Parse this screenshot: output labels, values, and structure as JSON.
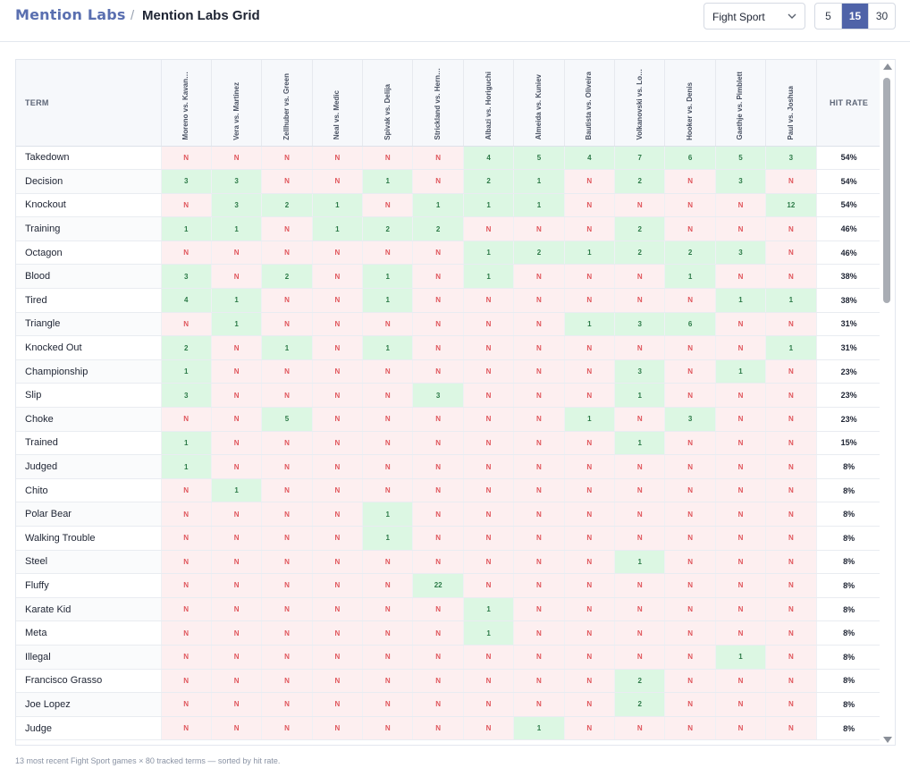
{
  "header": {
    "brand": "Mention Labs",
    "separator": "/",
    "title": "Mention Labs Grid",
    "sport_select": {
      "value": "Fight Sport",
      "icon": "chevron-down-icon"
    },
    "counts": [
      {
        "label": "5",
        "active": false
      },
      {
        "label": "15",
        "active": true
      },
      {
        "label": "30",
        "active": false
      }
    ]
  },
  "grid": {
    "term_header": "TERM",
    "rate_header": "HIT RATE",
    "games": [
      "Moreno vs. Kavan…",
      "Vera vs. Martinez",
      "Zellhuber vs. Green",
      "Neal vs. Medic",
      "Spivak vs. Delija",
      "Strickland vs. Hern…",
      "Albazi vs. Horiguchi",
      "Almeida vs. Kuniev",
      "Bautista vs. Oliveira",
      "Volkanovski vs. Lo…",
      "Hooker vs. Denis",
      "Gaethje vs. Pimblett",
      "Paul vs. Joshua"
    ],
    "rows": [
      {
        "term": "Takedown",
        "cells": [
          "N",
          "N",
          "N",
          "N",
          "N",
          "N",
          "4",
          "5",
          "4",
          "7",
          "6",
          "5",
          "3"
        ],
        "rate": "54%"
      },
      {
        "term": "Decision",
        "cells": [
          "3",
          "3",
          "N",
          "N",
          "1",
          "N",
          "2",
          "1",
          "N",
          "2",
          "N",
          "3",
          "N"
        ],
        "rate": "54%"
      },
      {
        "term": "Knockout",
        "cells": [
          "N",
          "3",
          "2",
          "1",
          "N",
          "1",
          "1",
          "1",
          "N",
          "N",
          "N",
          "N",
          "12"
        ],
        "rate": "54%"
      },
      {
        "term": "Training",
        "cells": [
          "1",
          "1",
          "N",
          "1",
          "2",
          "2",
          "N",
          "N",
          "N",
          "2",
          "N",
          "N",
          "N"
        ],
        "rate": "46%"
      },
      {
        "term": "Octagon",
        "cells": [
          "N",
          "N",
          "N",
          "N",
          "N",
          "N",
          "1",
          "2",
          "1",
          "2",
          "2",
          "3",
          "N"
        ],
        "rate": "46%"
      },
      {
        "term": "Blood",
        "cells": [
          "3",
          "N",
          "2",
          "N",
          "1",
          "N",
          "1",
          "N",
          "N",
          "N",
          "1",
          "N",
          "N"
        ],
        "rate": "38%"
      },
      {
        "term": "Tired",
        "cells": [
          "4",
          "1",
          "N",
          "N",
          "1",
          "N",
          "N",
          "N",
          "N",
          "N",
          "N",
          "1",
          "1"
        ],
        "rate": "38%"
      },
      {
        "term": "Triangle",
        "cells": [
          "N",
          "1",
          "N",
          "N",
          "N",
          "N",
          "N",
          "N",
          "1",
          "3",
          "6",
          "N",
          "N"
        ],
        "rate": "31%"
      },
      {
        "term": "Knocked Out",
        "cells": [
          "2",
          "N",
          "1",
          "N",
          "1",
          "N",
          "N",
          "N",
          "N",
          "N",
          "N",
          "N",
          "1"
        ],
        "rate": "31%"
      },
      {
        "term": "Championship",
        "cells": [
          "1",
          "N",
          "N",
          "N",
          "N",
          "N",
          "N",
          "N",
          "N",
          "3",
          "N",
          "1",
          "N"
        ],
        "rate": "23%"
      },
      {
        "term": "Slip",
        "cells": [
          "3",
          "N",
          "N",
          "N",
          "N",
          "3",
          "N",
          "N",
          "N",
          "1",
          "N",
          "N",
          "N"
        ],
        "rate": "23%"
      },
      {
        "term": "Choke",
        "cells": [
          "N",
          "N",
          "5",
          "N",
          "N",
          "N",
          "N",
          "N",
          "1",
          "N",
          "3",
          "N",
          "N"
        ],
        "rate": "23%"
      },
      {
        "term": "Trained",
        "cells": [
          "1",
          "N",
          "N",
          "N",
          "N",
          "N",
          "N",
          "N",
          "N",
          "1",
          "N",
          "N",
          "N"
        ],
        "rate": "15%"
      },
      {
        "term": "Judged",
        "cells": [
          "1",
          "N",
          "N",
          "N",
          "N",
          "N",
          "N",
          "N",
          "N",
          "N",
          "N",
          "N",
          "N"
        ],
        "rate": "8%"
      },
      {
        "term": "Chito",
        "cells": [
          "N",
          "1",
          "N",
          "N",
          "N",
          "N",
          "N",
          "N",
          "N",
          "N",
          "N",
          "N",
          "N"
        ],
        "rate": "8%"
      },
      {
        "term": "Polar Bear",
        "cells": [
          "N",
          "N",
          "N",
          "N",
          "1",
          "N",
          "N",
          "N",
          "N",
          "N",
          "N",
          "N",
          "N"
        ],
        "rate": "8%"
      },
      {
        "term": "Walking Trouble",
        "cells": [
          "N",
          "N",
          "N",
          "N",
          "1",
          "N",
          "N",
          "N",
          "N",
          "N",
          "N",
          "N",
          "N"
        ],
        "rate": "8%"
      },
      {
        "term": "Steel",
        "cells": [
          "N",
          "N",
          "N",
          "N",
          "N",
          "N",
          "N",
          "N",
          "N",
          "1",
          "N",
          "N",
          "N"
        ],
        "rate": "8%"
      },
      {
        "term": "Fluffy",
        "cells": [
          "N",
          "N",
          "N",
          "N",
          "N",
          "22",
          "N",
          "N",
          "N",
          "N",
          "N",
          "N",
          "N"
        ],
        "rate": "8%"
      },
      {
        "term": "Karate Kid",
        "cells": [
          "N",
          "N",
          "N",
          "N",
          "N",
          "N",
          "1",
          "N",
          "N",
          "N",
          "N",
          "N",
          "N"
        ],
        "rate": "8%"
      },
      {
        "term": "Meta",
        "cells": [
          "N",
          "N",
          "N",
          "N",
          "N",
          "N",
          "1",
          "N",
          "N",
          "N",
          "N",
          "N",
          "N"
        ],
        "rate": "8%"
      },
      {
        "term": "Illegal",
        "cells": [
          "N",
          "N",
          "N",
          "N",
          "N",
          "N",
          "N",
          "N",
          "N",
          "N",
          "N",
          "1",
          "N"
        ],
        "rate": "8%"
      },
      {
        "term": "Francisco Grasso",
        "cells": [
          "N",
          "N",
          "N",
          "N",
          "N",
          "N",
          "N",
          "N",
          "N",
          "2",
          "N",
          "N",
          "N"
        ],
        "rate": "8%"
      },
      {
        "term": "Joe Lopez",
        "cells": [
          "N",
          "N",
          "N",
          "N",
          "N",
          "N",
          "N",
          "N",
          "N",
          "2",
          "N",
          "N",
          "N"
        ],
        "rate": "8%"
      },
      {
        "term": "Judge",
        "cells": [
          "N",
          "N",
          "N",
          "N",
          "N",
          "N",
          "N",
          "1",
          "N",
          "N",
          "N",
          "N",
          "N"
        ],
        "rate": "8%"
      }
    ]
  },
  "colors": {
    "hit_bg": "#dcf7e3",
    "hit_text": "#2c7a47",
    "miss_bg": "#fdeff0",
    "miss_text": "#e0565c",
    "accent": "#4f63a8"
  },
  "footer": "13 most recent Fight Sport games × 80 tracked terms — sorted by hit rate."
}
